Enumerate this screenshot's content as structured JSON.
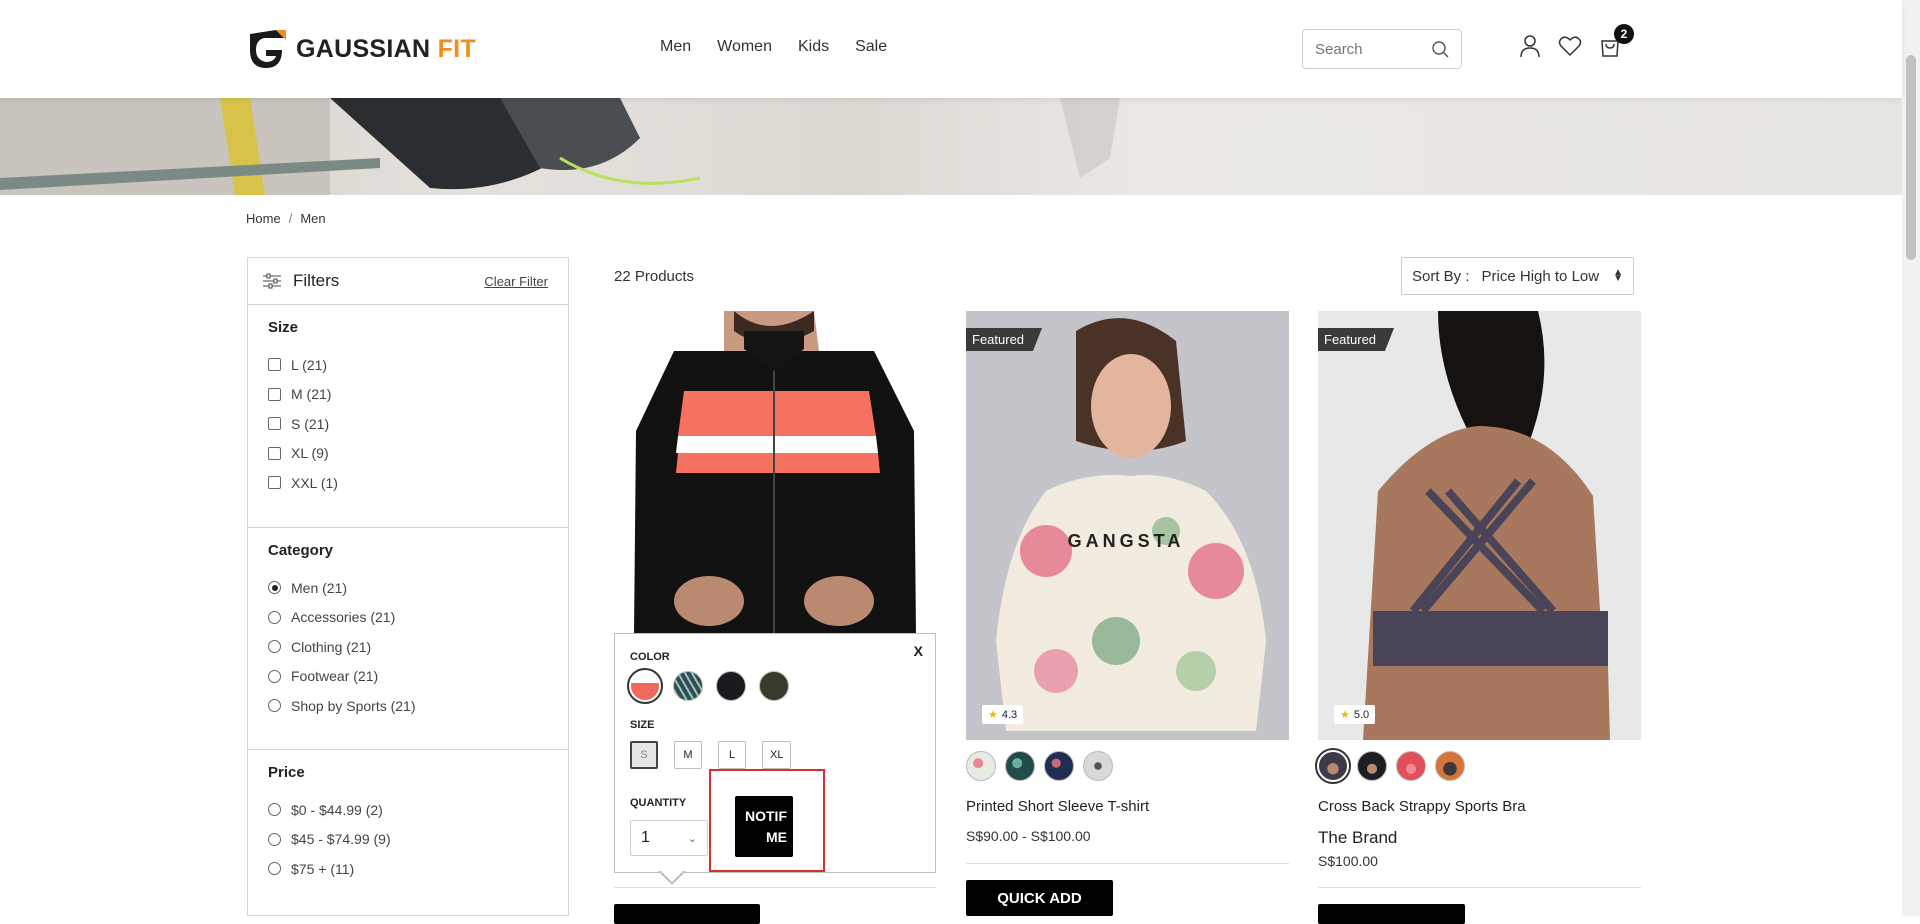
{
  "header": {
    "logo_text_main": "GAUSSIAN",
    "logo_text_accent": "FIT",
    "nav": [
      "Men",
      "Women",
      "Kids",
      "Sale"
    ],
    "search_placeholder": "Search",
    "cart_count": "2"
  },
  "breadcrumb": {
    "home": "Home",
    "separator": "/",
    "current": "Men"
  },
  "filters": {
    "title": "Filters",
    "clear": "Clear Filter",
    "size": {
      "title": "Size",
      "options": [
        "L (21)",
        "M (21)",
        "S (21)",
        "XL (9)",
        "XXL (1)"
      ]
    },
    "category": {
      "title": "Category",
      "options": [
        "Men (21)",
        "Accessories (21)",
        "Clothing (21)",
        "Footwear (21)",
        "Shop by Sports (21)"
      ],
      "selected": "Men (21)"
    },
    "price": {
      "title": "Price",
      "options": [
        "$0 - $44.99 (2)",
        "$45 - $74.99 (9)",
        "$75 + (11)"
      ]
    }
  },
  "listing": {
    "count": "22 Products",
    "sort_label": "Sort By :",
    "sort_value": "Price High to Low"
  },
  "products": [
    {
      "name": "",
      "quick_add_popup": {
        "color_label": "COLOR",
        "close": "X",
        "colors": [
          "#f06a5c",
          "#2f4f4f",
          "#1b1b1f",
          "#3a3a2c"
        ],
        "size_label": "SIZE",
        "sizes": [
          "S",
          "M",
          "L",
          "XL"
        ],
        "selected_size": "S",
        "quantity_label": "QUANTITY",
        "quantity": "1",
        "notify_line1": "NOTIF",
        "notify_line2": "ME"
      }
    },
    {
      "badge": "Featured",
      "rating": "4.3",
      "swatch_colors": [
        "#e7ece3",
        "#224c4a",
        "#1f2e52",
        "#d9d9dc"
      ],
      "name": "Printed Short Sleeve T-shirt",
      "price": "S$90.00 - S$100.00",
      "button": "QUICK ADD"
    },
    {
      "badge": "Featured",
      "rating": "5.0",
      "swatch_colors": [
        "#3e3a4a",
        "#1e1e22",
        "#e0505a",
        "#3a3a3a"
      ],
      "name": "Cross Back Strappy Sports Bra",
      "brand": "The Brand",
      "price": "S$100.00"
    }
  ]
}
